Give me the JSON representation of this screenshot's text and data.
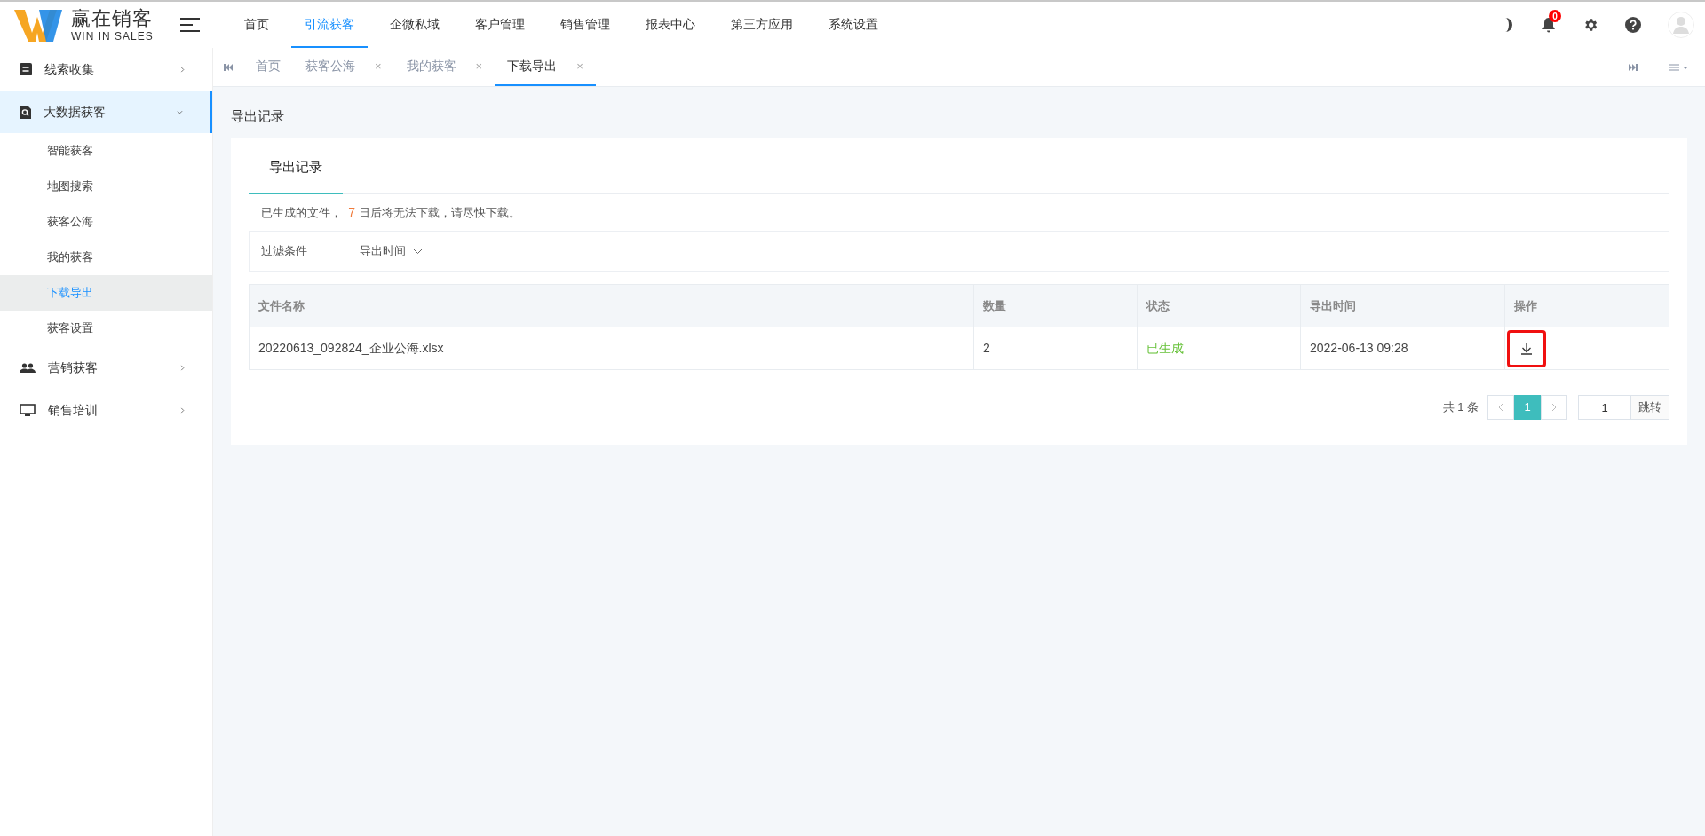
{
  "logo": {
    "title": "赢在销客",
    "subtitle": "WIN IN SALES"
  },
  "top_nav": [
    {
      "label": "首页",
      "selected": false
    },
    {
      "label": "引流获客",
      "selected": true
    },
    {
      "label": "企微私域",
      "selected": false
    },
    {
      "label": "客户管理",
      "selected": false
    },
    {
      "label": "销售管理",
      "selected": false
    },
    {
      "label": "报表中心",
      "selected": false
    },
    {
      "label": "第三方应用",
      "selected": false
    },
    {
      "label": "系统设置",
      "selected": false
    }
  ],
  "notification_count": "0",
  "sidebar": {
    "items": [
      {
        "label": "线索收集",
        "kind": "doc",
        "expanded": false,
        "selected": false
      },
      {
        "label": "大数据获客",
        "kind": "search",
        "expanded": true,
        "selected": true,
        "children": [
          {
            "label": "智能获客",
            "selected": false
          },
          {
            "label": "地图搜索",
            "selected": false
          },
          {
            "label": "获客公海",
            "selected": false
          },
          {
            "label": "我的获客",
            "selected": false
          },
          {
            "label": "下载导出",
            "selected": true
          },
          {
            "label": "获客设置",
            "selected": false
          }
        ]
      },
      {
        "label": "营销获客",
        "kind": "people",
        "expanded": false,
        "selected": false
      },
      {
        "label": "销售培训",
        "kind": "screen",
        "expanded": false,
        "selected": false
      }
    ]
  },
  "page_tabs": [
    {
      "label": "首页",
      "closable": false,
      "selected": false
    },
    {
      "label": "获客公海",
      "closable": true,
      "selected": false
    },
    {
      "label": "我的获客",
      "closable": true,
      "selected": false
    },
    {
      "label": "下载导出",
      "closable": true,
      "selected": true
    }
  ],
  "close_glyph": "×",
  "page_title": "导出记录",
  "card_tab": "导出记录",
  "notice": {
    "before": "已生成的文件，",
    "days": "7",
    "after": "日后将无法下载，请尽快下载。"
  },
  "filter": {
    "label": "过滤条件",
    "dropdown": "导出时间"
  },
  "table": {
    "columns": [
      "文件名称",
      "数量",
      "状态",
      "导出时间",
      "操作"
    ],
    "rows": [
      {
        "file": "20220613_092824_企业公海.xlsx",
        "count": "2",
        "status": "已生成",
        "time": "2022-06-13 09:28",
        "highlighted": true
      }
    ]
  },
  "pagination": {
    "total": "共 1 条",
    "current": "1",
    "jump_value": "1",
    "jump_button": "跳转"
  }
}
